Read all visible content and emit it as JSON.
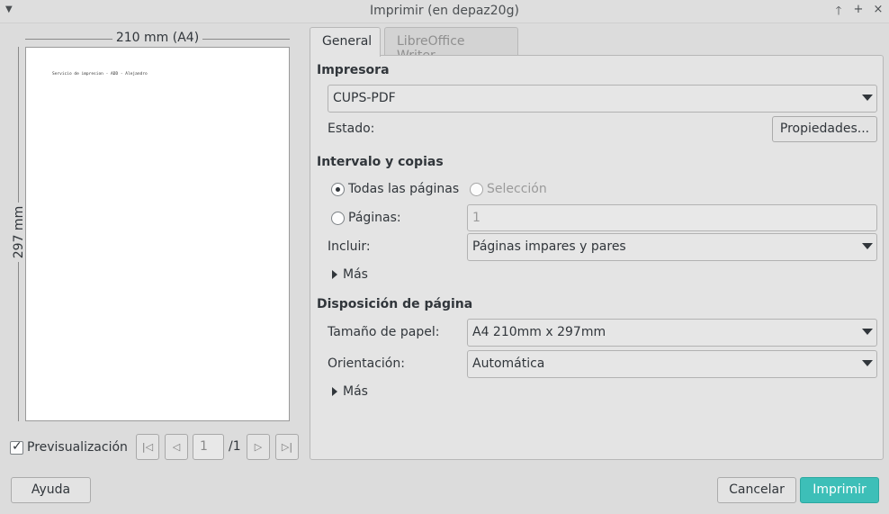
{
  "window": {
    "title": "Imprimir (en depaz20g)"
  },
  "preview": {
    "width_label": "210 mm (A4)",
    "height_label": "297 mm",
    "page_text": "Servicio de impresion - ADD - Alejandro",
    "checkbox_label": "Previsualización",
    "checkbox_checked": true,
    "page_number": "1",
    "page_total": "/1"
  },
  "tabs": [
    {
      "label": "General",
      "active": true
    },
    {
      "label": "LibreOffice Writer",
      "active": false
    }
  ],
  "printer": {
    "section_title": "Impresora",
    "selected": "CUPS-PDF",
    "status_label": "Estado:",
    "properties_button": "Propiedades..."
  },
  "range": {
    "section_title": "Intervalo y copias",
    "all_pages_label": "Todas las páginas",
    "selection_label": "Selección",
    "pages_label": "Páginas:",
    "pages_value": "1",
    "include_label": "Incluir:",
    "include_value": "Páginas impares y pares",
    "more_label": "Más"
  },
  "layout": {
    "section_title": "Disposición de página",
    "paper_size_label": "Tamaño de papel:",
    "paper_size_value": "A4 210mm x 297mm",
    "orientation_label": "Orientación:",
    "orientation_value": "Automática",
    "more_label": "Más"
  },
  "buttons": {
    "help": "Ayuda",
    "cancel": "Cancelar",
    "print": "Imprimir"
  },
  "colors": {
    "accent": "#3dbfb8",
    "background": "#dcdcdc"
  }
}
